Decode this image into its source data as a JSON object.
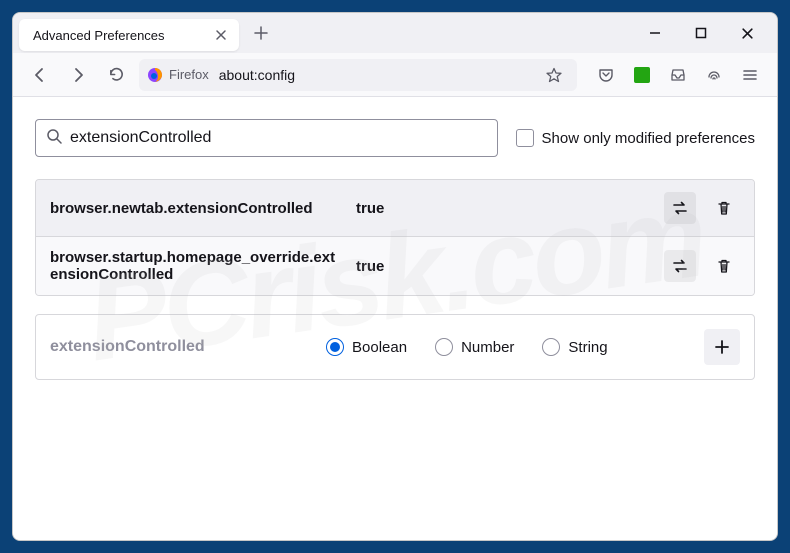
{
  "window": {
    "tab_title": "Advanced Preferences"
  },
  "toolbar": {
    "firefox_label": "Firefox",
    "url": "about:config"
  },
  "search": {
    "value": "extensionControlled",
    "show_modified_label": "Show only modified preferences"
  },
  "prefs": [
    {
      "name": "browser.newtab.extensionControlled",
      "value": "true"
    },
    {
      "name": "browser.startup.homepage_override.extensionControlled",
      "value": "true"
    }
  ],
  "new_pref": {
    "name": "extensionControlled",
    "types": {
      "boolean": "Boolean",
      "number": "Number",
      "string": "String"
    }
  },
  "watermark": "PCrisk.com"
}
